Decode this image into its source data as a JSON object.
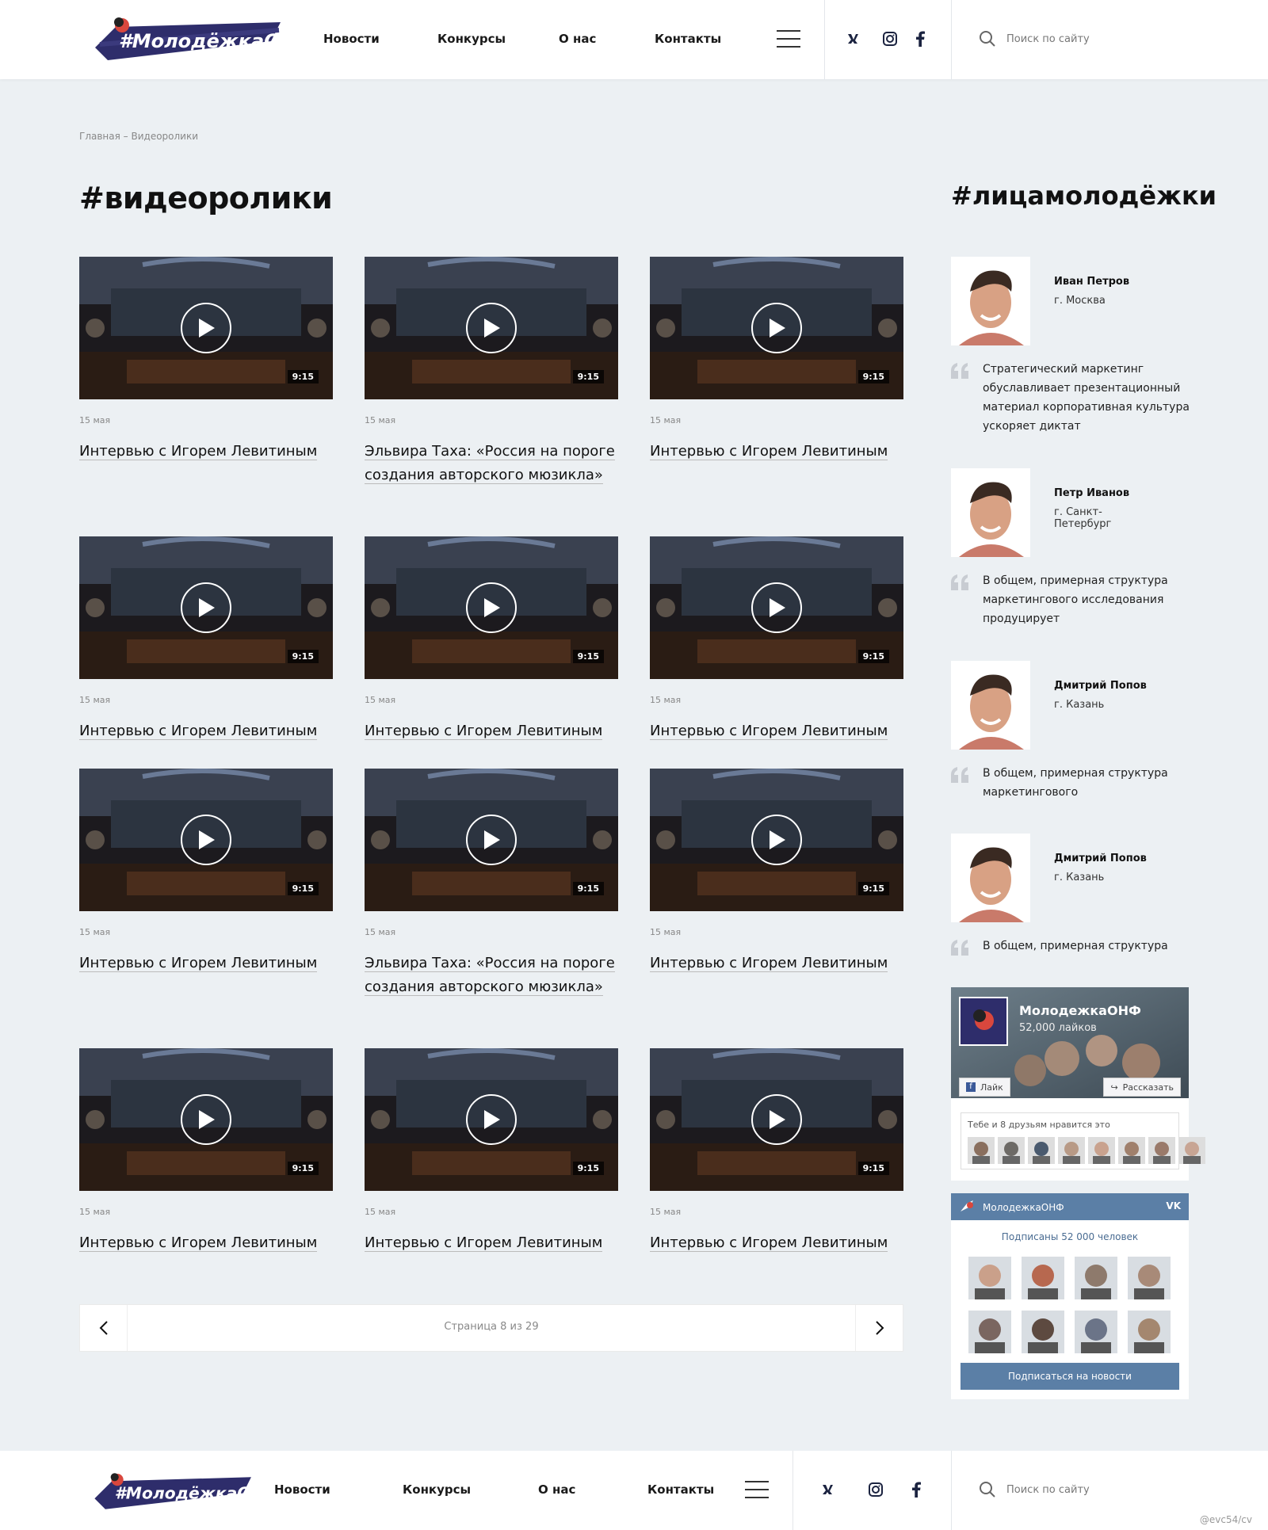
{
  "header": {
    "logo_text": "#МолодёжкаОНФ",
    "nav": [
      "Новости",
      "Конкурсы",
      "О нас",
      "Контакты"
    ],
    "search_placeholder": "Поиск по сайту"
  },
  "breadcrumb": {
    "home": "Главная",
    "separator": " – ",
    "current": "Видеоролики"
  },
  "page_title": "#видеоролики",
  "videos": [
    {
      "date": "15 мая",
      "title": "Интервью с Игорем Левитиным",
      "duration": "9:15"
    },
    {
      "date": "15 мая",
      "title": "Эльвира Таха: «Россия на пороге создания авторского мюзикла»",
      "duration": "9:15"
    },
    {
      "date": "15 мая",
      "title": "Интервью с Игорем Левитиным",
      "duration": "9:15"
    },
    {
      "date": "15 мая",
      "title": "Интервью с Игорем Левитиным",
      "duration": "9:15"
    },
    {
      "date": "15 мая",
      "title": "Интервью с Игорем Левитиным",
      "duration": "9:15"
    },
    {
      "date": "15 мая",
      "title": "Интервью с Игорем Левитиным",
      "duration": "9:15"
    },
    {
      "date": "15 мая",
      "title": "Интервью с Игорем Левитиным",
      "duration": "9:15"
    },
    {
      "date": "15 мая",
      "title": "Эльвира Таха: «Россия на пороге создания авторского мюзикла»",
      "duration": "9:15"
    },
    {
      "date": "15 мая",
      "title": "Интервью с Игорем Левитиным",
      "duration": "9:15"
    },
    {
      "date": "15 мая",
      "title": "Интервью с Игорем Левитиным",
      "duration": "9:15"
    },
    {
      "date": "15 мая",
      "title": "Интервью с Игорем Левитиным",
      "duration": "9:15"
    },
    {
      "date": "15 мая",
      "title": "Интервью с Игорем Левитиным",
      "duration": "9:15"
    }
  ],
  "pagination": {
    "label": "Страница 8 из 29",
    "current": 8,
    "total": 29
  },
  "sidebar": {
    "title": "#лицамолодёжки",
    "people": [
      {
        "name": "Иван Петров",
        "city": "г. Москва",
        "quote": "Стратегический маркетинг обуславливает презентационный материал корпоративная культура ускоряет диктат"
      },
      {
        "name": "Петр Иванов",
        "city": "г. Санкт-Петербург",
        "quote": "В общем, примерная структура маркетингового исследования продуцирует"
      },
      {
        "name": "Дмитрий Попов",
        "city": "г. Казань",
        "quote": "В общем, примерная структура маркетингового"
      },
      {
        "name": "Дмитрий Попов",
        "city": "г. Казань",
        "quote": "В общем, примерная структура"
      }
    ]
  },
  "fb_widget": {
    "page_name": "МолодежкаОНФ",
    "likes": "52,000 лайков",
    "like_label": "Лайк",
    "share_label": "Рассказать",
    "friends_text": "Тебе и 8 друзьям нравится это"
  },
  "vk_widget": {
    "group_name": "МолодежкаОНФ",
    "subscribers": "Подписаны 52 000 человек",
    "subscribe_label": "Подписаться на новости"
  },
  "footer": {
    "logo_text": "#МолодёжкаОНФ",
    "nav": [
      "Новости",
      "Конкурсы",
      "О нас",
      "Контакты"
    ],
    "search_placeholder": "Поиск по сайту"
  },
  "watermark": "@evc54/cv",
  "colors": {
    "accent": "#2e2d6b",
    "vk": "#5b7fa6",
    "bg": "#ecf0f3"
  }
}
